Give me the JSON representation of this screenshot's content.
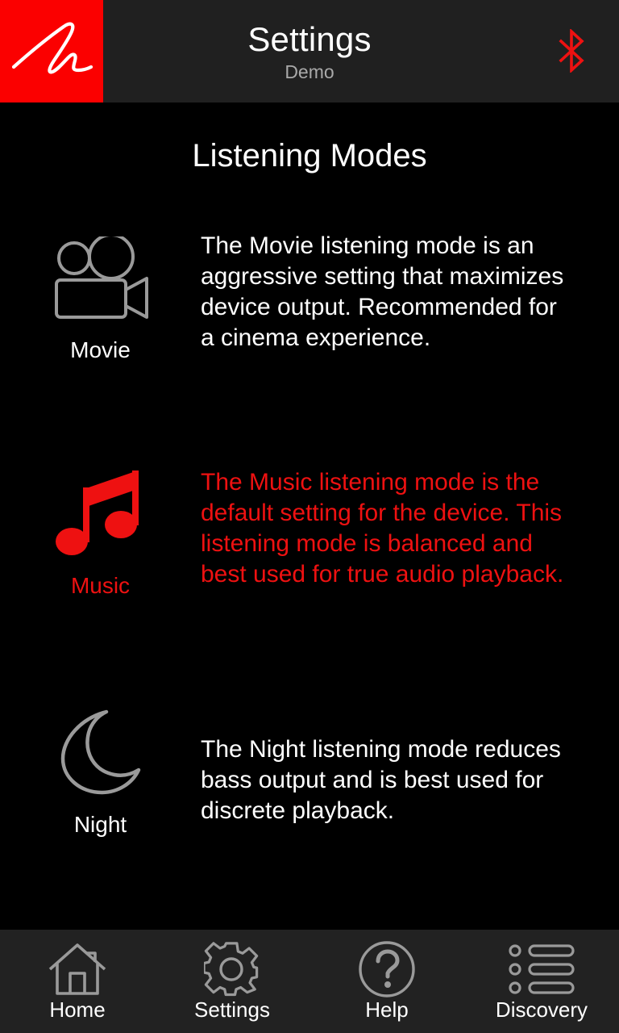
{
  "header": {
    "logo_alt": "brand-script-m-logo",
    "title": "Settings",
    "subtitle": "Demo",
    "bluetooth_icon": "bluetooth-icon",
    "bg_color": "#202020",
    "logo_bg_color": "#fb0000"
  },
  "main": {
    "page_title": "Listening Modes",
    "accent_color": "#ee1111",
    "icon_outline_color": "#9a9a9a",
    "modes": [
      {
        "id": "movie",
        "icon": "movie-camera-icon",
        "label": "Movie",
        "description": "The Movie listening mode is an aggressive setting that maximizes device output. Recommended for a cinema experience.",
        "active": false
      },
      {
        "id": "music",
        "icon": "music-note-icon",
        "label": "Music",
        "description": "The Music listening mode is the default setting for the device. This listening mode is balanced and best used for true audio playback.",
        "active": true
      },
      {
        "id": "night",
        "icon": "crescent-moon-icon",
        "label": "Night",
        "description": "The Night listening mode reduces bass output and is best used for discrete playback.",
        "active": false
      }
    ]
  },
  "navbar": {
    "bg_color": "#222222",
    "items": [
      {
        "id": "home",
        "icon": "home-icon",
        "label": "Home"
      },
      {
        "id": "settings",
        "icon": "gear-icon",
        "label": "Settings"
      },
      {
        "id": "help",
        "icon": "question-mark-circle-icon",
        "label": "Help"
      },
      {
        "id": "discovery",
        "icon": "bulleted-list-icon",
        "label": "Discovery"
      }
    ]
  }
}
